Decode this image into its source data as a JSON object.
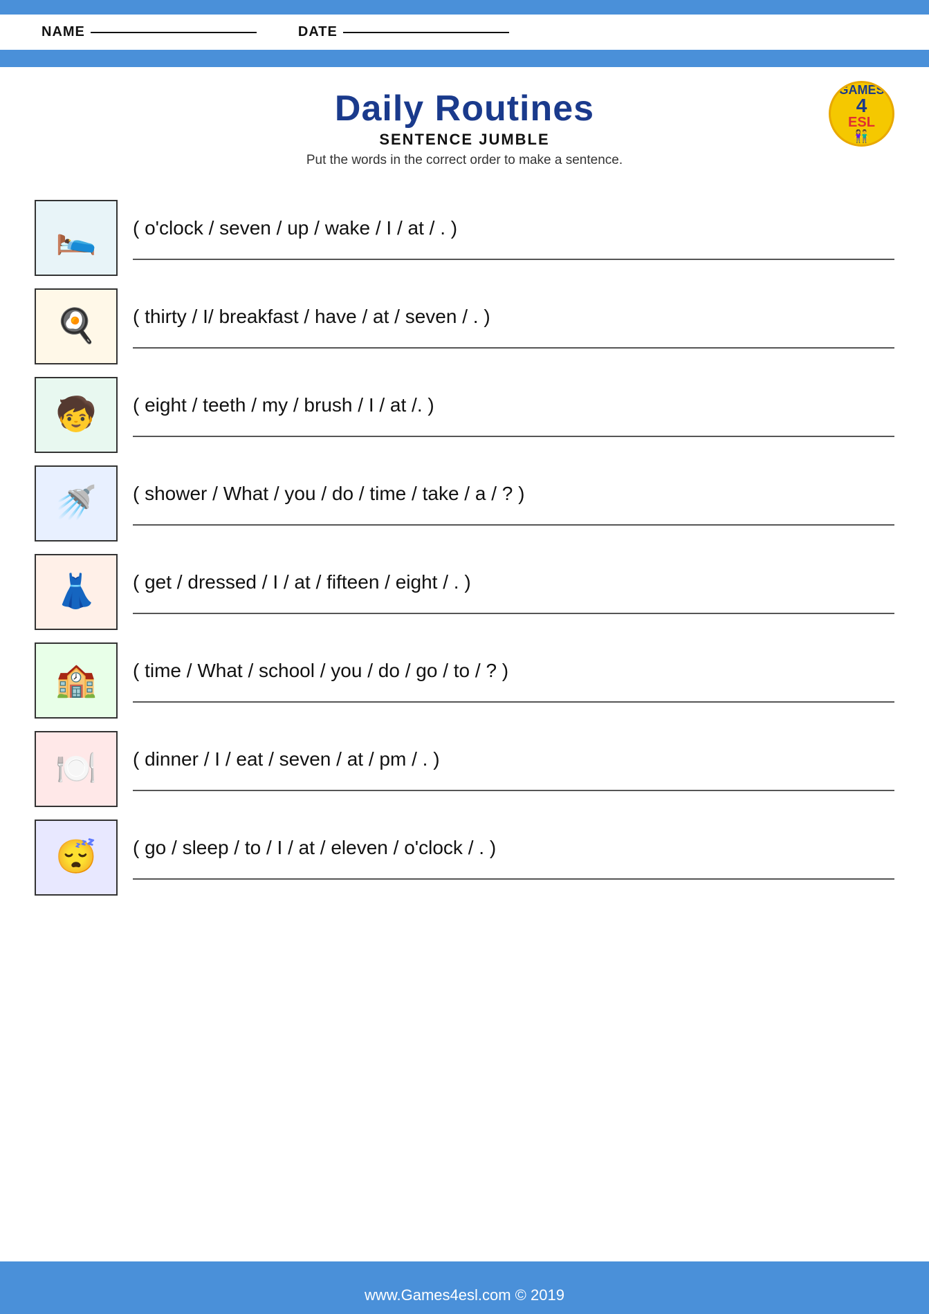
{
  "header": {
    "name_label": "NAME",
    "date_label": "DATE"
  },
  "title": {
    "main": "Daily Routines",
    "subtitle": "SENTENCE JUMBLE",
    "instructions": "Put the words in the correct order to make a sentence.",
    "logo_games": "GAMES",
    "logo_4": "4",
    "logo_esl": "ESL"
  },
  "sentences": [
    {
      "id": 1,
      "text": "( o'clock / seven / up / wake / I / at / . )",
      "emoji": "🛌",
      "scene_class": "scene-wakeup"
    },
    {
      "id": 2,
      "text": "( thirty / I/ breakfast / have / at / seven / . )",
      "emoji": "🍳",
      "scene_class": "scene-breakfast"
    },
    {
      "id": 3,
      "text": "( eight / teeth / my / brush / I / at /. )",
      "emoji": "🧒",
      "scene_class": "scene-teeth"
    },
    {
      "id": 4,
      "text": "( shower / What / you / do / time / take / a / ? )",
      "emoji": "🚿",
      "scene_class": "scene-shower"
    },
    {
      "id": 5,
      "text": "( get / dressed / I / at / fifteen / eight / . )",
      "emoji": "👗",
      "scene_class": "scene-dressed"
    },
    {
      "id": 6,
      "text": "( time / What / school / you / do / go  / to / ? )",
      "emoji": "🏫",
      "scene_class": "scene-school"
    },
    {
      "id": 7,
      "text": "( dinner / I / eat / seven / at / pm / . )",
      "emoji": "🍽️",
      "scene_class": "scene-dinner"
    },
    {
      "id": 8,
      "text": "( go / sleep / to / I / at / eleven / o'clock / . )",
      "emoji": "😴",
      "scene_class": "scene-sleep"
    }
  ],
  "footer": {
    "text": "www.Games4esl.com © 2019"
  }
}
